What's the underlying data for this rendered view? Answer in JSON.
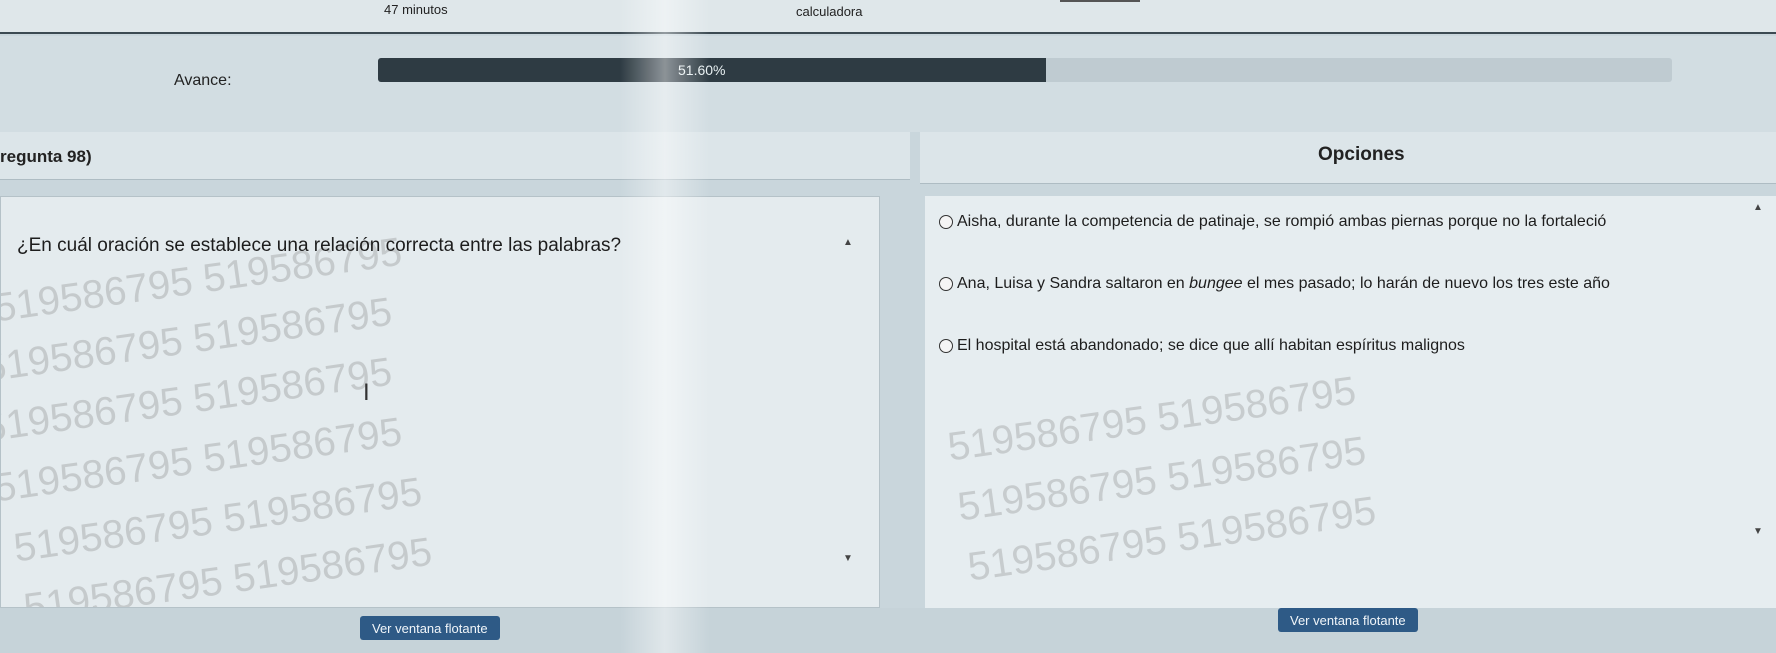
{
  "topbar": {
    "timer": "47 minutos",
    "calculator": "calculadora"
  },
  "progress": {
    "label": "Avance:",
    "value_text": "51.60%",
    "value": 51.6
  },
  "question": {
    "header": "regunta 98)",
    "text": "¿En cuál oración se establece una relación correcta entre las palabras?"
  },
  "options": {
    "header": "Opciones",
    "items": [
      {
        "text": "Aisha, durante la competencia de patinaje, se rompió ambas piernas porque no la fortaleció"
      },
      {
        "text_before": "Ana, Luisa y Sandra saltaron en ",
        "text_italic": "bungee",
        "text_after": " el mes pasado; lo harán de nuevo los tres este año"
      },
      {
        "text": "El hospital está abandonado; se dice que allí habitan espíritus malignos"
      }
    ]
  },
  "watermark": "519586795 519586795",
  "buttons": {
    "float_left": "Ver ventana flotante",
    "float_right": "Ver ventana flotante"
  },
  "colors": {
    "progress_fill": "#2e3b43",
    "button": "#2e5a86"
  }
}
